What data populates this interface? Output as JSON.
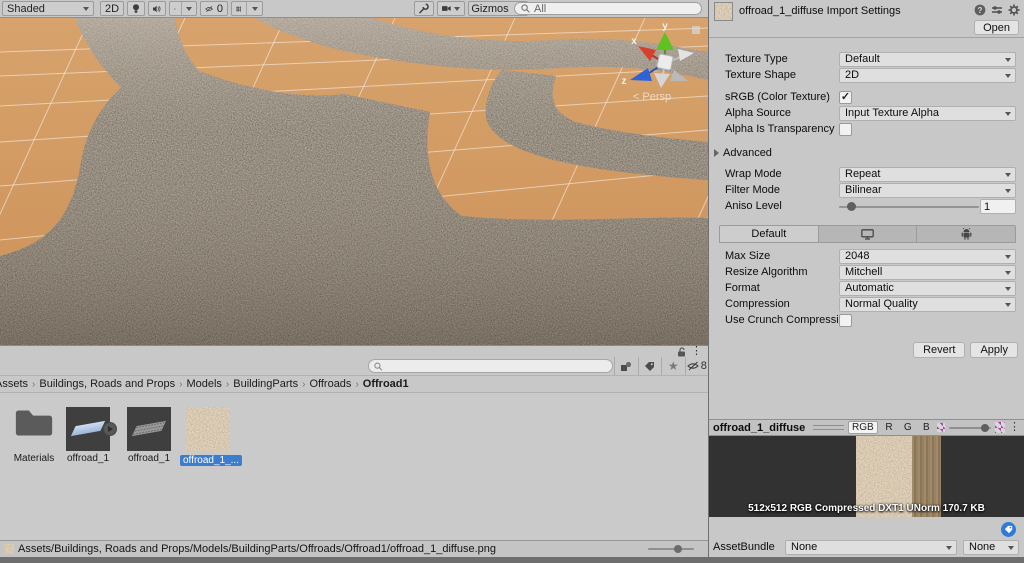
{
  "scene_toolbar": {
    "shading_mode": "Shaded",
    "mode_2d": "2D",
    "effects_count": "0",
    "gizmos_label": "Gizmos",
    "search_value": "All"
  },
  "scene": {
    "persp_label": "< Persp",
    "axis": {
      "x": "x",
      "y": "y",
      "z": "z"
    },
    "colors": {
      "ground": "#d29b64",
      "grid": "#ffffff",
      "road": "#aba091",
      "axis_x": "#e03e2d",
      "axis_y": "#6fc72e",
      "axis_z": "#2d6ee0"
    }
  },
  "inspector": {
    "title": "offroad_1_diffuse Import Settings",
    "open_label": "Open",
    "texture_type": {
      "label": "Texture Type",
      "value": "Default"
    },
    "texture_shape": {
      "label": "Texture Shape",
      "value": "2D"
    },
    "srgb": {
      "label": "sRGB (Color Texture)",
      "checked": true
    },
    "alpha_source": {
      "label": "Alpha Source",
      "value": "Input Texture Alpha"
    },
    "alpha_transparency": {
      "label": "Alpha Is Transparency",
      "checked": false
    },
    "advanced_label": "Advanced",
    "wrap_mode": {
      "label": "Wrap Mode",
      "value": "Repeat"
    },
    "filter_mode": {
      "label": "Filter Mode",
      "value": "Bilinear"
    },
    "aniso": {
      "label": "Aniso Level",
      "value": "1"
    },
    "platform_tab_default": "Default",
    "max_size": {
      "label": "Max Size",
      "value": "2048"
    },
    "resize_algorithm": {
      "label": "Resize Algorithm",
      "value": "Mitchell"
    },
    "format": {
      "label": "Format",
      "value": "Automatic"
    },
    "compression": {
      "label": "Compression",
      "value": "Normal Quality"
    },
    "crunch": {
      "label": "Use Crunch Compressio",
      "checked": false
    },
    "revert_label": "Revert",
    "apply_label": "Apply"
  },
  "preview": {
    "title": "offroad_1_diffuse",
    "channels": [
      "RGB",
      "R",
      "G",
      "B"
    ],
    "info": "512x512  RGB Compressed DXT1 UNorm   170.7 KB"
  },
  "assetbundle": {
    "label": "AssetBundle",
    "primary": "None",
    "variant": "None"
  },
  "project": {
    "breadcrumb": [
      "Assets",
      "Buildings, Roads and Props",
      "Models",
      "BuildingParts",
      "Offroads",
      "Offroad1"
    ],
    "hidden_count": "8",
    "items": [
      {
        "label": "Materials",
        "type": "folder"
      },
      {
        "label": "offroad_1",
        "type": "model"
      },
      {
        "label": "offroad_1",
        "type": "mesh"
      },
      {
        "label": "offroad_1_...",
        "type": "texture",
        "selected": true
      }
    ]
  },
  "status_bar": {
    "path": "Assets/Buildings, Roads and Props/Models/BuildingParts/Offroads/Offroad1/offroad_1_diffuse.png"
  },
  "icons": {
    "star": "★",
    "menu_dots": "⋮",
    "check": "✓"
  }
}
